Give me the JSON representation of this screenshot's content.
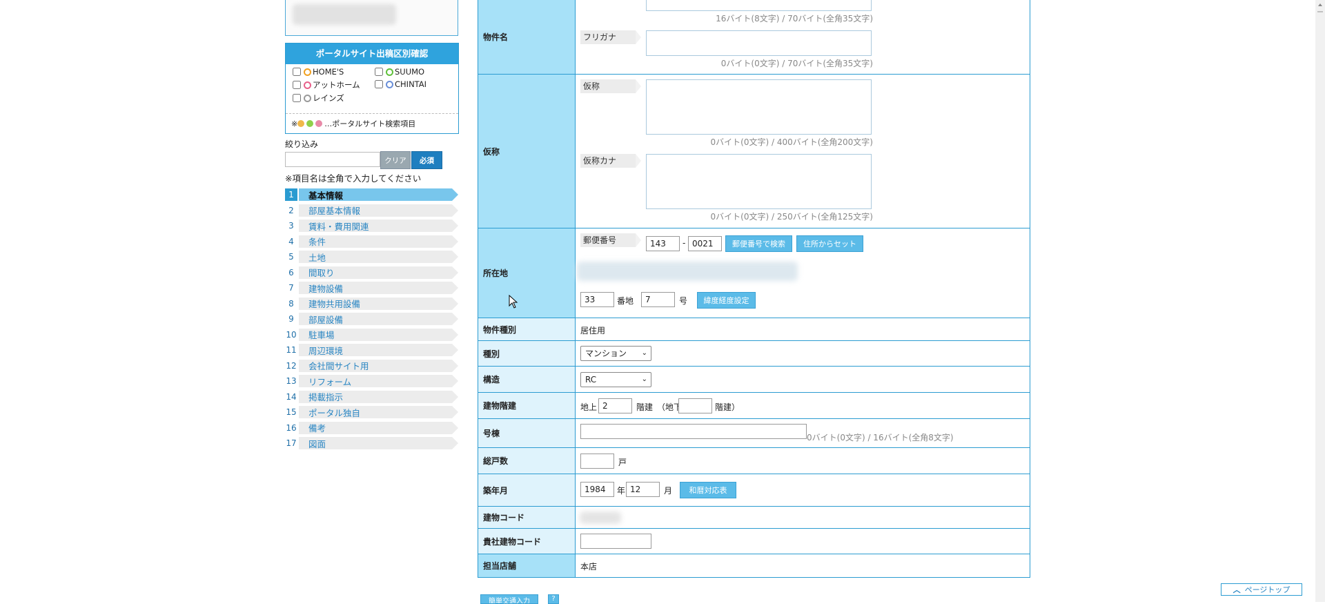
{
  "portal": {
    "title": "ポータルサイト出稿区別確認",
    "options": [
      {
        "label": "HOME'S",
        "color": "#f0a020"
      },
      {
        "label": "SUUMO",
        "color": "#5fc03a"
      },
      {
        "label": "アットホーム",
        "color": "#e8608a"
      },
      {
        "label": "CHINTAI",
        "color": "#6a8fd8"
      },
      {
        "label": "レインズ",
        "color": "#999999"
      }
    ],
    "note_prefix": "※",
    "note_suffix": "…ポータルサイト検索項目",
    "dot_colors": [
      "#f0b84a",
      "#8fd04a",
      "#e88aa8"
    ]
  },
  "filter": {
    "label": "絞り込み",
    "value": "",
    "clear_label": "クリア",
    "required_label": "必須",
    "note": "※項目名は全角で入力してください"
  },
  "nav": {
    "items": [
      {
        "num": "1",
        "label": "基本情報",
        "active": true
      },
      {
        "num": "2",
        "label": "部屋基本情報"
      },
      {
        "num": "3",
        "label": "賃料・費用関連"
      },
      {
        "num": "4",
        "label": "条件"
      },
      {
        "num": "5",
        "label": "土地"
      },
      {
        "num": "6",
        "label": "間取り"
      },
      {
        "num": "7",
        "label": "建物設備"
      },
      {
        "num": "8",
        "label": "建物共用設備"
      },
      {
        "num": "9",
        "label": "部屋設備"
      },
      {
        "num": "10",
        "label": "駐車場"
      },
      {
        "num": "11",
        "label": "周辺環境"
      },
      {
        "num": "12",
        "label": "会社間サイト用"
      },
      {
        "num": "13",
        "label": "リフォーム"
      },
      {
        "num": "14",
        "label": "掲載指示"
      },
      {
        "num": "15",
        "label": "ポータル独自"
      },
      {
        "num": "16",
        "label": "備考"
      },
      {
        "num": "17",
        "label": "図面"
      }
    ]
  },
  "form": {
    "name": {
      "label": "物件名",
      "counter1": "16バイト(8文字) / 70バイト(全角35文字)",
      "kana_label": "フリガナ",
      "counter2": "0バイト(0文字) / 70バイト(全角35文字)"
    },
    "alias": {
      "label": "仮称",
      "sub1": "仮称",
      "counter1": "0バイト(0文字) / 400バイト(全角200文字)",
      "sub2": "仮称カナ",
      "counter2": "0バイト(0文字) / 250バイト(全角125文字)"
    },
    "address": {
      "label": "所在地",
      "zip_label": "郵便番号",
      "zip1": "143",
      "zip_sep": "-",
      "zip2": "0021",
      "zip_search_btn": "郵便番号で検索",
      "from_addr_btn": "住所からセット",
      "banchi": "33",
      "banchi_unit": "番地",
      "go": "7",
      "go_unit": "号",
      "latlng_btn": "緯度経度設定"
    },
    "property_type": {
      "label": "物件種別",
      "value": "居住用"
    },
    "kind": {
      "label": "種別",
      "value": "マンション"
    },
    "structure": {
      "label": "構造",
      "value": "RC"
    },
    "floors": {
      "label": "建物階建",
      "above_prefix": "地上",
      "above": "2",
      "above_suffix": "階建",
      "below_prefix": "（地下",
      "below": "",
      "below_suffix": "階建）"
    },
    "building_no": {
      "label": "号棟",
      "value": "",
      "counter": "0バイト(0文字) / 16バイト(全角8文字)"
    },
    "units": {
      "label": "総戸数",
      "value": "",
      "unit": "戸"
    },
    "built": {
      "label": "築年月",
      "year": "1984",
      "year_unit": "年",
      "month": "12",
      "month_unit": "月",
      "btn": "和暦対応表"
    },
    "building_code": {
      "label": "建物コード"
    },
    "your_code": {
      "label": "貴社建物コード",
      "value": ""
    },
    "store": {
      "label": "担当店舗",
      "value": "本店"
    }
  },
  "footer": {
    "pagetop": "ページトップ",
    "btn1": "簡単交通入力",
    "btn2": "?"
  }
}
